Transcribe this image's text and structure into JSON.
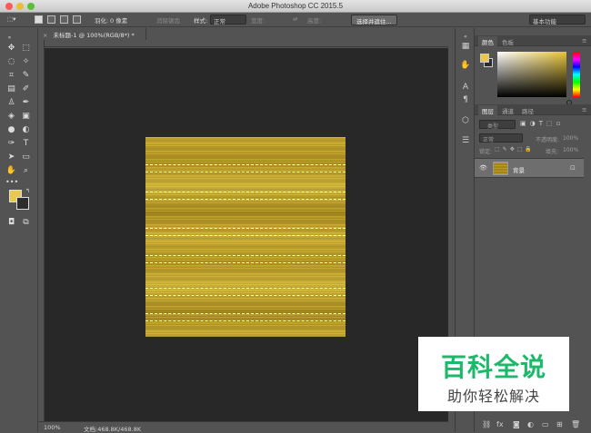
{
  "app_title": "Adobe Photoshop CC 2015.5",
  "options": {
    "feather_label": "羽化:",
    "feather_value": "0 像素",
    "antialias_label": "消除锯齿",
    "style_label": "样式:",
    "style_value": "正常",
    "width_label": "宽度:",
    "height_label": "高度:",
    "select_mask_button": "选择并遮住...",
    "workspace_value": "基本功能"
  },
  "document": {
    "tab_title": "未标题-1 @ 100%(RGB/8*) *",
    "close_glyph": "×"
  },
  "status": {
    "zoom": "100%",
    "doc_size": "文档:468.8K/468.8K"
  },
  "panels": {
    "color_tabs": [
      "颜色",
      "色板"
    ],
    "layers_tabs": [
      "图层",
      "通道",
      "路径"
    ],
    "kind_filter": "类型",
    "blend_mode": "正常",
    "opacity_label": "不透明度:",
    "opacity_value": "100%",
    "lock_label": "锁定:",
    "fill_label": "填充:",
    "fill_value": "100%",
    "layer_name": "背景"
  },
  "colors": {
    "foreground": "#e8c94a",
    "background": "#2c2c2c",
    "canvas_bg": "#282828",
    "chrome": "#535353",
    "watermark_green": "#1db96b"
  },
  "icons": [
    "move-icon",
    "marquee-icon",
    "lasso-icon",
    "magic-wand-icon",
    "crop-icon",
    "eyedropper-icon",
    "healing-icon",
    "brush-icon",
    "stamp-icon",
    "history-brush-icon",
    "eraser-icon",
    "gradient-icon",
    "blur-icon",
    "dodge-icon",
    "pen-icon",
    "type-icon",
    "path-select-icon",
    "shape-icon",
    "hand-icon",
    "zoom-icon"
  ],
  "watermark": {
    "title": "百科全说",
    "subtitle": "助你轻松解决"
  }
}
